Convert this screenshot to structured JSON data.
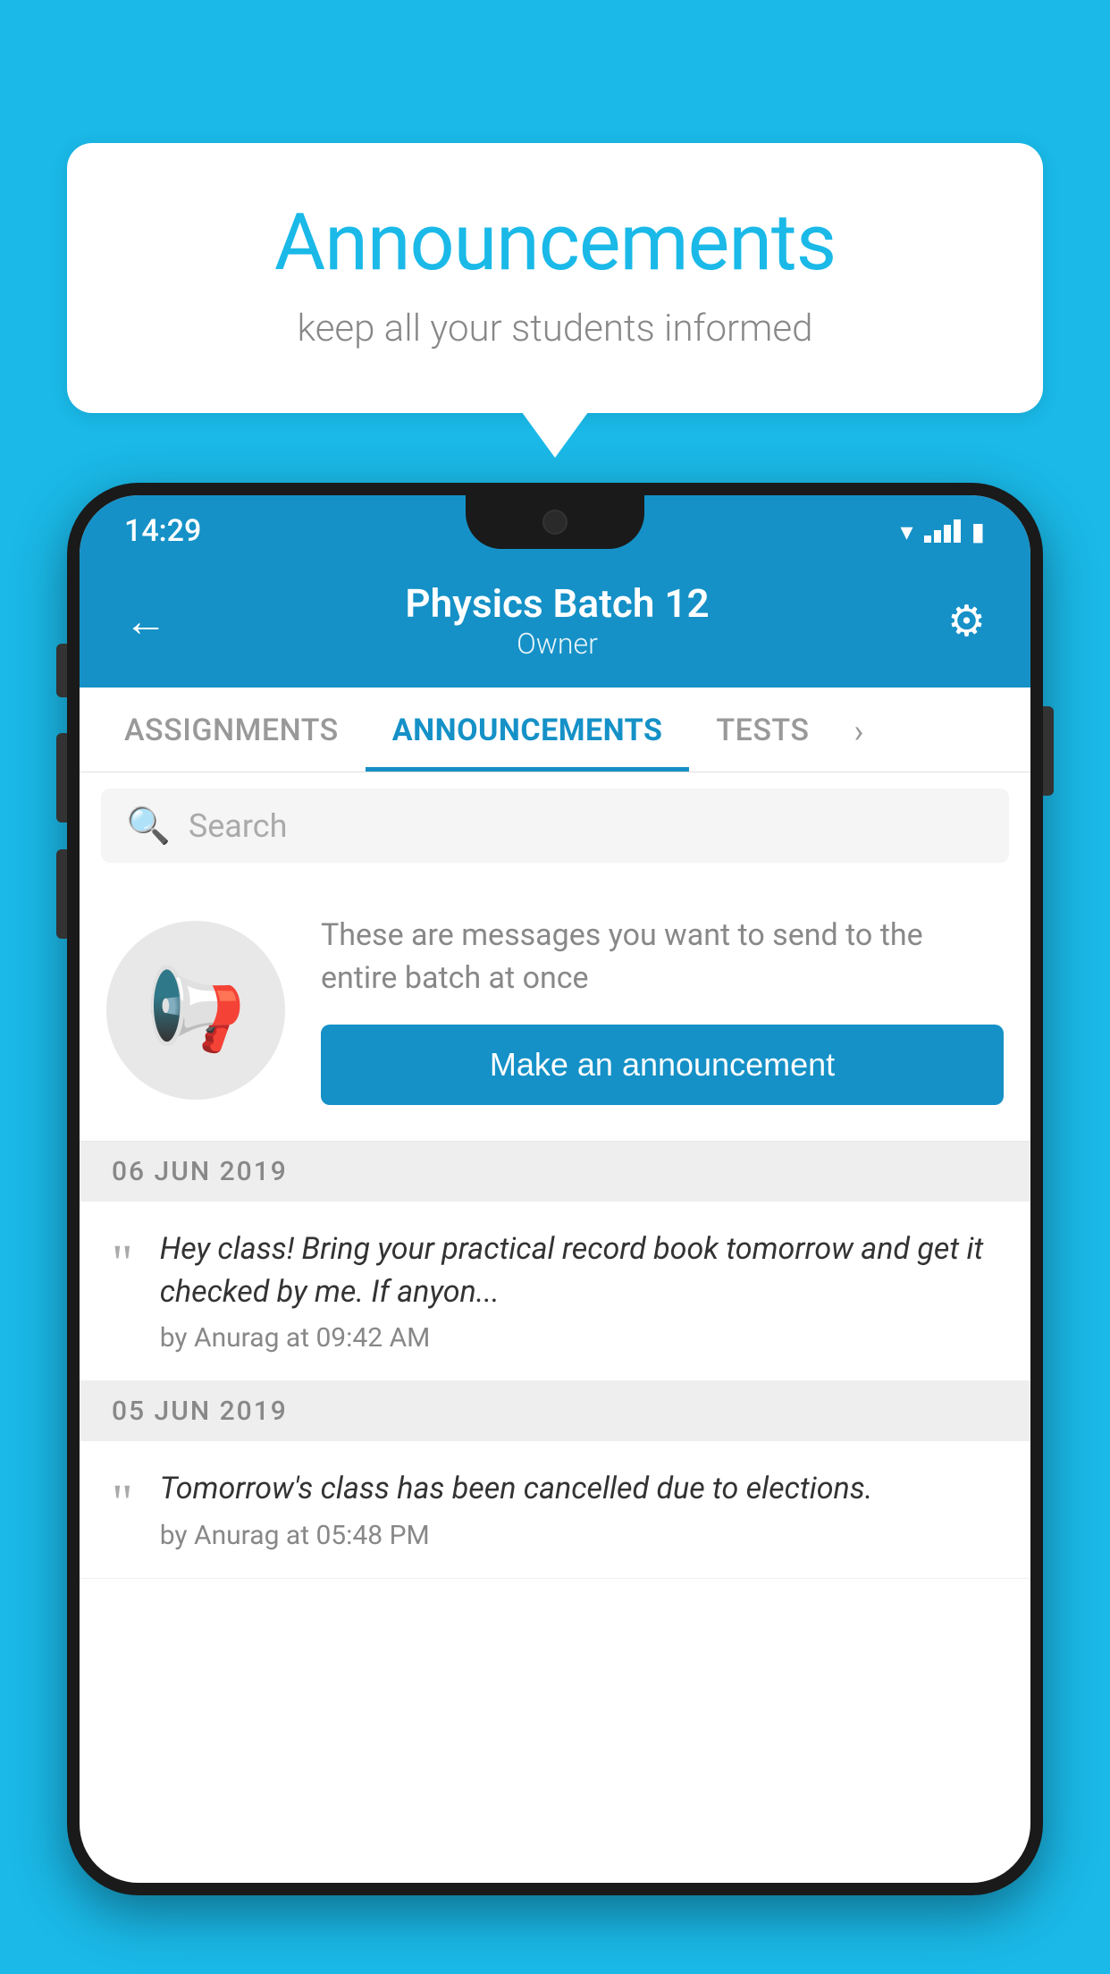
{
  "bubble": {
    "title": "Announcements",
    "subtitle": "keep all your students informed"
  },
  "phone": {
    "status": {
      "time": "14:29"
    },
    "header": {
      "batch_name": "Physics Batch 12",
      "owner_label": "Owner",
      "back_label": "←",
      "settings_label": "⚙"
    },
    "tabs": [
      {
        "label": "ASSIGNMENTS",
        "active": false
      },
      {
        "label": "ANNOUNCEMENTS",
        "active": true
      },
      {
        "label": "TESTS",
        "active": false
      }
    ],
    "search": {
      "placeholder": "Search"
    },
    "announcement_prompt": {
      "description": "These are messages you want to send to the entire batch at once",
      "button_label": "Make an announcement"
    },
    "announcements": [
      {
        "date": "06  JUN  2019",
        "text": "Hey class! Bring your practical record book tomorrow and get it checked by me. If anyon...",
        "author": "by Anurag at 09:42 AM"
      },
      {
        "date": "05  JUN  2019",
        "text": "Tomorrow's class has been cancelled due to elections.",
        "author": "by Anurag at 05:48 PM"
      }
    ]
  },
  "colors": {
    "primary": "#1591c7",
    "background": "#1ab9e8",
    "white": "#ffffff",
    "gray_text": "#888888",
    "dark_text": "#333333"
  }
}
